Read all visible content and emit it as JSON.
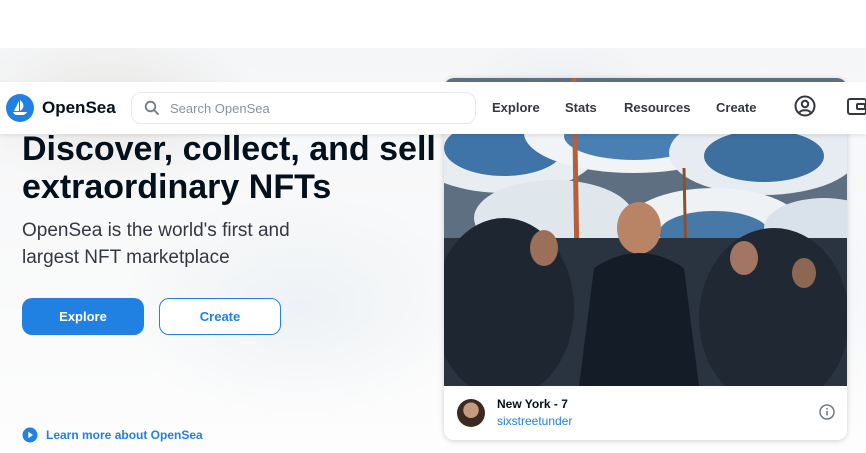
{
  "brand": {
    "name": "OpenSea",
    "accent": "#2081e2"
  },
  "search": {
    "placeholder": "Search OpenSea"
  },
  "nav": {
    "links": [
      "Explore",
      "Stats",
      "Resources",
      "Create"
    ],
    "icons": [
      "account-icon",
      "wallet-icon"
    ]
  },
  "hero": {
    "headline": "Discover, collect, and sell extraordinary NFTs",
    "subline": "OpenSea is the world's first and largest NFT marketplace",
    "explore_label": "Explore",
    "create_label": "Create",
    "learn_more": "Learn more about OpenSea"
  },
  "featured": {
    "title": "New York - 7",
    "creator": "sixstreetunder"
  }
}
